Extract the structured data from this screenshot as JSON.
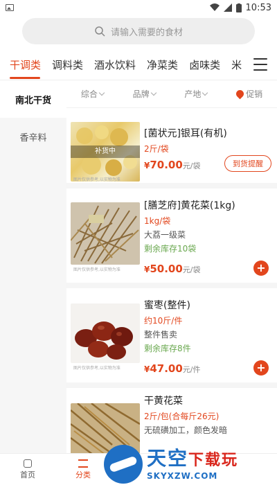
{
  "status": {
    "time": "10:53"
  },
  "search": {
    "placeholder": "请输入需要的食材"
  },
  "category_tabs": [
    "干调类",
    "调料类",
    "酒水饮料",
    "净菜类",
    "卤味类",
    "米"
  ],
  "sidebar": [
    "南北干货",
    "香辛料"
  ],
  "filters": [
    "综合",
    "品牌",
    "产地",
    "促销"
  ],
  "thumb_note": "图片仅供参考,以实物为准",
  "restock_overlay": "补货中",
  "products": [
    {
      "name": "[菌状元]银耳(有机)",
      "spec": "2斤/袋",
      "desc": "",
      "stock": "",
      "currency": "¥",
      "price": "70.00",
      "unit": "元/袋",
      "action": "到货提醒"
    },
    {
      "name": "[膳芝府]黄花菜(1kg)",
      "spec": "1kg/袋",
      "desc": "大荔一级菜",
      "stock": "剩余库存10袋",
      "currency": "¥",
      "price": "50.00",
      "unit": "元/袋",
      "action": "+"
    },
    {
      "name": "蜜枣(整件)",
      "spec": "约10斤/件",
      "desc": "整件售卖",
      "stock": "剩余库存8件",
      "currency": "¥",
      "price": "47.00",
      "unit": "元/件",
      "action": "+"
    },
    {
      "name": "干黄花菜",
      "spec": "2斤/包(合每斤26元)",
      "desc": "无硫磺加工，颜色发暗",
      "stock": "",
      "currency": "",
      "price": "",
      "unit": "",
      "action": ""
    }
  ],
  "bottom_nav": [
    "首页",
    "分类"
  ],
  "watermark": {
    "main": "天空",
    "accent": "下载玩",
    "sub": "SKYXZW.COM"
  },
  "colors": {
    "accent": "#e2461d",
    "stock_green": "#6aa84f",
    "watermark_blue": "#1f6fc4"
  }
}
